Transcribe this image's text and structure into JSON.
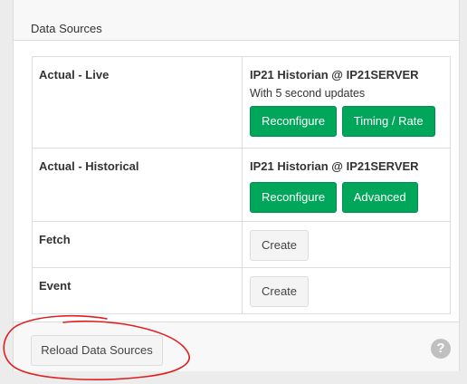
{
  "panel": {
    "title": "Data Sources"
  },
  "rows": [
    {
      "label": "Actual - Live",
      "source": "IP21 Historian @ IP21SERVER",
      "subtitle": "With 5 second updates",
      "buttons": [
        "Reconfigure",
        "Timing / Rate"
      ]
    },
    {
      "label": "Actual - Historical",
      "source": "IP21 Historian @ IP21SERVER",
      "buttons": [
        "Reconfigure",
        "Advanced"
      ]
    },
    {
      "label": "Fetch",
      "create_label": "Create"
    },
    {
      "label": "Event",
      "create_label": "Create"
    }
  ],
  "footer": {
    "reload_label": "Reload Data Sources",
    "help_glyph": "?"
  },
  "icons": {
    "help": "question-circle-icon"
  },
  "colors": {
    "success": "#00a65a",
    "annotation": "#e02020"
  }
}
